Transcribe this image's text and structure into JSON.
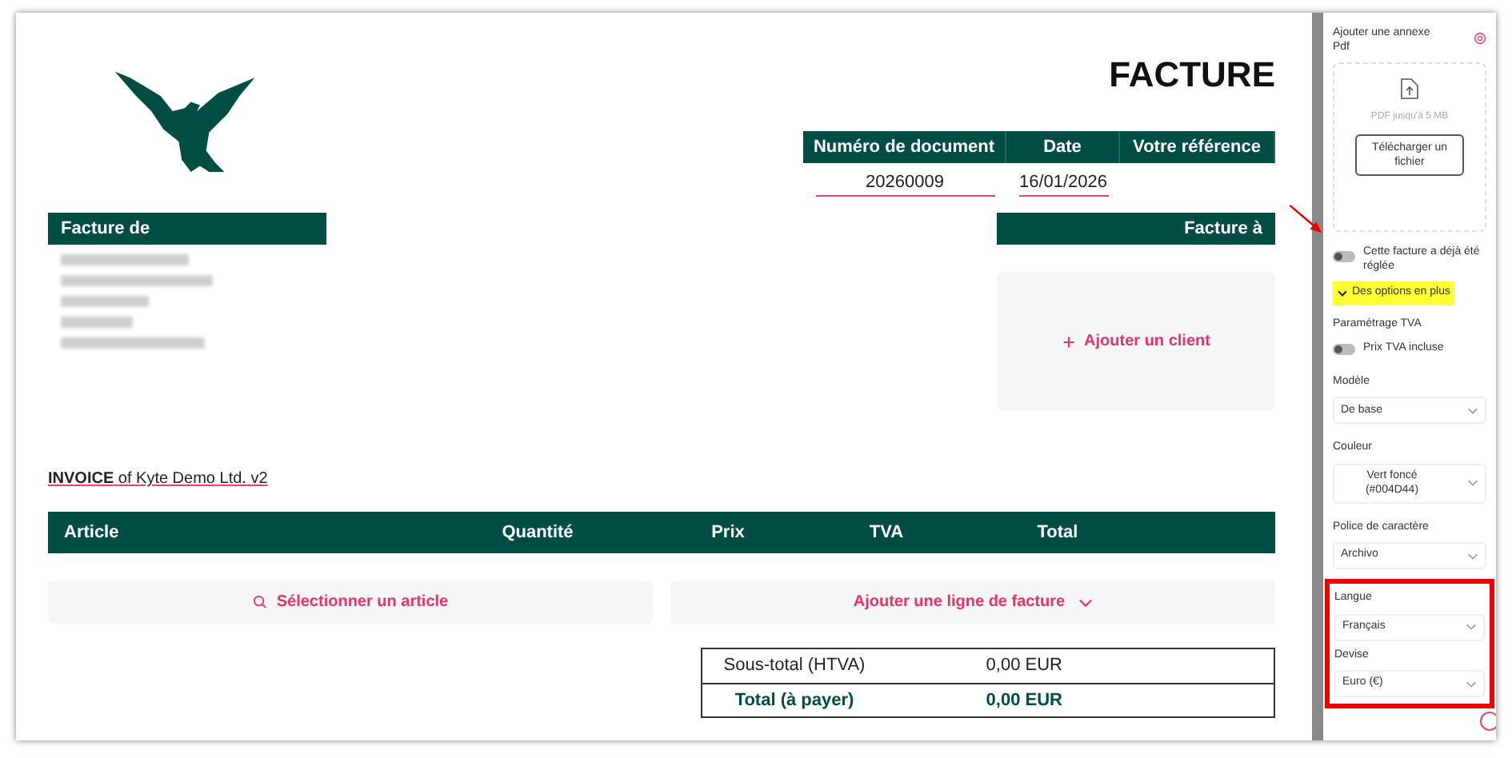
{
  "title": "FACTURE",
  "doc_table": {
    "columns": [
      "Numéro de document",
      "Date",
      "Votre référence"
    ],
    "values": [
      "20260009",
      "16/01/2026"
    ]
  },
  "sender": {
    "heading": "Facture de",
    "address_lines": [
      {
        "kind": "redacted"
      },
      {
        "kind": "redacted"
      },
      {
        "kind": "redacted"
      },
      {
        "kind": "redacted"
      },
      {
        "kind": "redacted"
      }
    ]
  },
  "recipient": {
    "heading": "Facture à",
    "add_button": "Ajouter un client"
  },
  "invoice_note": "**INVOICE** of Kyte Demo Ltd. v2",
  "items_table": {
    "columns": [
      "Article",
      "Quantité",
      "Prix",
      "TVA",
      "Total"
    ]
  },
  "actions": [
    {
      "kind": "search",
      "label": "Sélectionner un article"
    },
    {
      "kind": "dropdown",
      "label": "Ajouter une ligne de facture"
    }
  ],
  "totals": [
    {
      "kind": "subtotal",
      "label": "Sous-total (HTVA)",
      "value": "0,00 EUR"
    },
    {
      "kind": "total",
      "label": "Total (à payer)",
      "value": "0,00 EUR"
    }
  ],
  "sidebar": {
    "attachment": {
      "label": "Ajouter une annexe Pdf",
      "hint": "PDF jusqu'à 5 MB",
      "button": "Télécharger un fichier"
    },
    "settled_toggle": {
      "label": "Cette facture a déjà été réglée",
      "on": false
    },
    "more_options": {
      "label": "Des options en plus",
      "expanded": true,
      "highlighted": true
    },
    "vat": {
      "heading": "Paramétrage TVA",
      "toggle": {
        "label": "Prix TVA incluse",
        "on": false
      }
    },
    "selects": [
      {
        "label": "Modèle",
        "value": "De base",
        "highlighted": false
      },
      {
        "label": "Couleur",
        "value": "Vert foncé (#004D44)",
        "highlighted": false
      },
      {
        "label": "Police de caractère",
        "value": "Archivo",
        "highlighted": false
      },
      {
        "label": "Langue",
        "value": "Français",
        "highlighted": true
      },
      {
        "label": "Devise",
        "value": "Euro (€)",
        "highlighted": true
      }
    ]
  }
}
